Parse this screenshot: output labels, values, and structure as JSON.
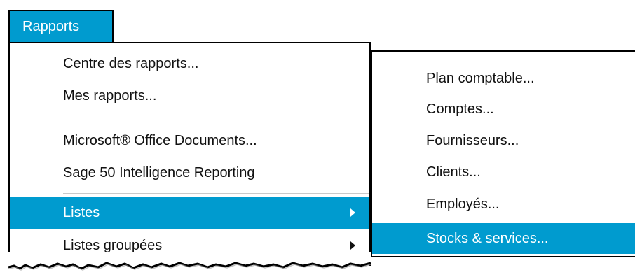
{
  "menu": {
    "title": "Rapports"
  },
  "dropdown": {
    "items": [
      {
        "label": "Centre des rapports..."
      },
      {
        "label": "Mes rapports..."
      },
      {
        "label": "Microsoft® Office Documents..."
      },
      {
        "label": "Sage 50 Intelligence Reporting"
      },
      {
        "label": "Listes"
      },
      {
        "label": "Listes groupées"
      }
    ]
  },
  "submenu": {
    "items": [
      {
        "label": "Plan comptable..."
      },
      {
        "label": "Comptes..."
      },
      {
        "label": "Fournisseurs..."
      },
      {
        "label": "Clients..."
      },
      {
        "label": "Employés..."
      },
      {
        "label": "Stocks & services..."
      }
    ]
  },
  "colors": {
    "accent": "#009bcf",
    "text": "#111111",
    "border": "#000000",
    "separator": "#c9c9c9"
  },
  "icons": {
    "submenu_arrow": "chevron-right-icon"
  }
}
